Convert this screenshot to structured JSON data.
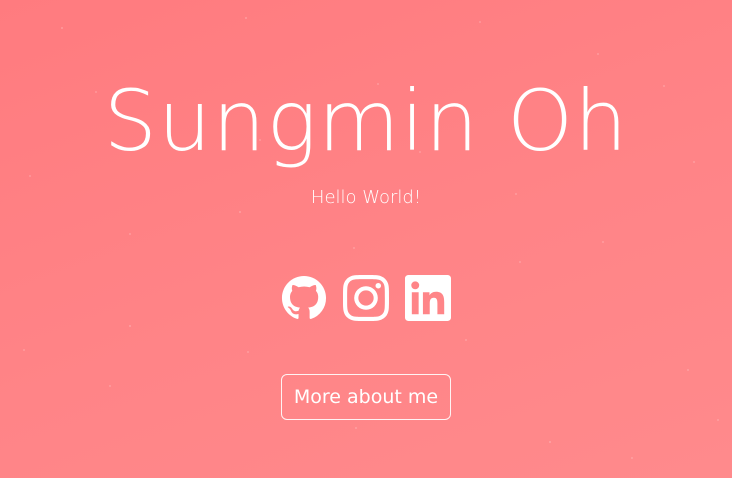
{
  "hero": {
    "name": "Sungmin Oh",
    "tagline": "Hello World!",
    "more_button_label": "More about me"
  },
  "social_links": [
    {
      "icon": "github-icon",
      "label": "GitHub"
    },
    {
      "icon": "instagram-icon",
      "label": "Instagram"
    },
    {
      "icon": "linkedin-icon",
      "label": "LinkedIn"
    }
  ],
  "colors": {
    "background": "#ff8084",
    "foreground": "#ffffff"
  }
}
